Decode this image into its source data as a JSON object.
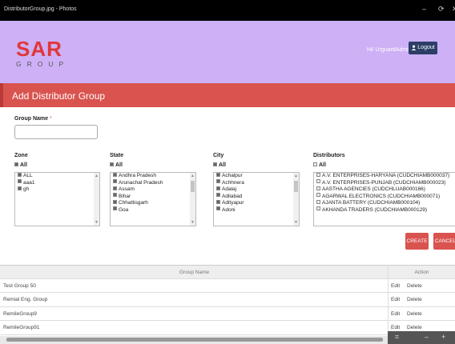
{
  "window": {
    "title": "DistributorGroup.jpg - Photos",
    "minimize_glyph": "–",
    "restore_glyph": "⟳",
    "close_glyph": "✕"
  },
  "header": {
    "logo_main": "SAR",
    "logo_sub": "GROUP",
    "greeting": "Hi! UrguardAdmin",
    "logout_label": "Logout",
    "logout_icon": "user-icon"
  },
  "page": {
    "title": "Add Distributor Group"
  },
  "form": {
    "group_name_label": "Group Name",
    "required_mark": "*",
    "group_name_value": "",
    "zone": {
      "label": "Zone",
      "all_label": "All",
      "all_checked": true,
      "items": [
        {
          "text": "ALL",
          "checked": true
        },
        {
          "text": "aaa1",
          "checked": true
        },
        {
          "text": "gh",
          "checked": true
        }
      ]
    },
    "state": {
      "label": "State",
      "all_label": "All",
      "all_checked": true,
      "items": [
        {
          "text": "Andhra Pradesh",
          "checked": true
        },
        {
          "text": "Arunachal Pradesh",
          "checked": true
        },
        {
          "text": "Assam",
          "checked": true
        },
        {
          "text": "Bihar",
          "checked": true
        },
        {
          "text": "Chhattisgarh",
          "checked": true
        },
        {
          "text": "Goa",
          "checked": true
        }
      ]
    },
    "city": {
      "label": "City",
      "all_label": "All",
      "all_checked": true,
      "items": [
        {
          "text": "Achalpur",
          "checked": true
        },
        {
          "text": "Achhnera",
          "checked": true
        },
        {
          "text": "Adalaj",
          "checked": true
        },
        {
          "text": "Adilabad",
          "checked": true
        },
        {
          "text": "Adityapur",
          "checked": true
        },
        {
          "text": "Adoni",
          "checked": true
        }
      ]
    },
    "distributors": {
      "label": "Distributors",
      "all_label": "All",
      "all_checked": false,
      "items": [
        {
          "text": "A.V. ENTERPRISES-HARYANA (CUDCHIAMB000037)",
          "checked": false
        },
        {
          "text": "A.V. ENTERPRISES-PUNJAB (CUDCHIAMB000023)",
          "checked": false
        },
        {
          "text": "AASTHA AGENCIES (CUDCHLUAB000166)",
          "checked": false
        },
        {
          "text": "AGARWAL ELECTRONICS (CUDCHIAMB000071)",
          "checked": false
        },
        {
          "text": "AJANTA BATTERY (CUDCHIAMB000104)",
          "checked": false
        },
        {
          "text": "AKHANDA TRADERS (CUDCHIAMB000129)",
          "checked": false
        }
      ]
    },
    "create_label": "CREATE",
    "cancel_label": "CANCEL"
  },
  "table": {
    "headers": {
      "group_name": "Group Name",
      "action": "Action"
    },
    "rows": [
      {
        "name": "Test Group 50",
        "edit": "Edit",
        "delete": "Delete"
      },
      {
        "name": "Remial Eng. Group",
        "edit": "Edit",
        "delete": "Delete"
      },
      {
        "name": "RemileGroup9",
        "edit": "Edit",
        "delete": "Delete"
      },
      {
        "name": "RemileGroup91",
        "edit": "Edit",
        "delete": "Delete"
      }
    ]
  },
  "viewer": {
    "zoom_icons": [
      "fit-icon",
      "zoom-out-icon",
      "zoom-in-icon"
    ],
    "fit_glyph": "⌗",
    "zoom_out_glyph": "–",
    "zoom_in_glyph": "+"
  },
  "colors": {
    "header_bg": "#cdb0f6",
    "accent_red": "#d9534f",
    "logout_bg": "#2c3e67"
  }
}
